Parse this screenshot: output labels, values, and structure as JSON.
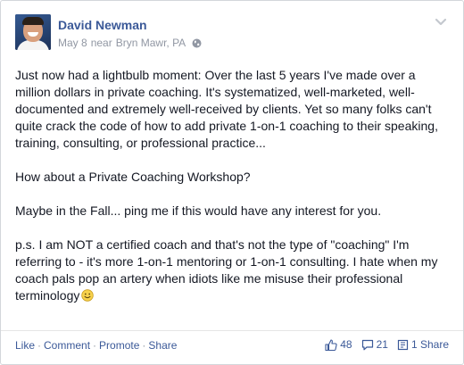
{
  "post": {
    "author": "David Newman",
    "date": "May 8",
    "near_label": "near",
    "location": "Bryn Mawr, PA",
    "paragraphs": [
      "Just now had a lightbulb moment: Over the last 5 years I've made over a million dollars in private coaching. It's systematized, well-marketed, well-documented and extremely well-received by clients. Yet so many folks can't quite crack the code of how to add private 1-on-1 coaching to their speaking, training, consulting, or professional practice...",
      "How about a Private Coaching Workshop?",
      "Maybe in the Fall... ping me if this would have any interest for you.",
      "p.s. I am NOT a certified coach and that's not the type of \"coaching\" I'm referring to - it's more 1-on-1 mentoring or 1-on-1 consulting. I hate when my coach pals pop an artery when idiots like me misuse their professional terminology"
    ],
    "emoji": "smile-emoji"
  },
  "footer": {
    "actions": [
      "Like",
      "Comment",
      "Promote",
      "Share"
    ],
    "separator": "·",
    "likes_count": "48",
    "comments_count": "21",
    "shares_label": "1 Share"
  },
  "icons": {
    "menu": "chevron-down-icon",
    "privacy": "globe-icon",
    "likes": "thumbs-up-icon",
    "comments": "comment-icon",
    "shares": "share-icon"
  },
  "colors": {
    "link": "#3b5998",
    "muted": "#9197a3",
    "text": "#141823",
    "border": "#d3d6db"
  }
}
